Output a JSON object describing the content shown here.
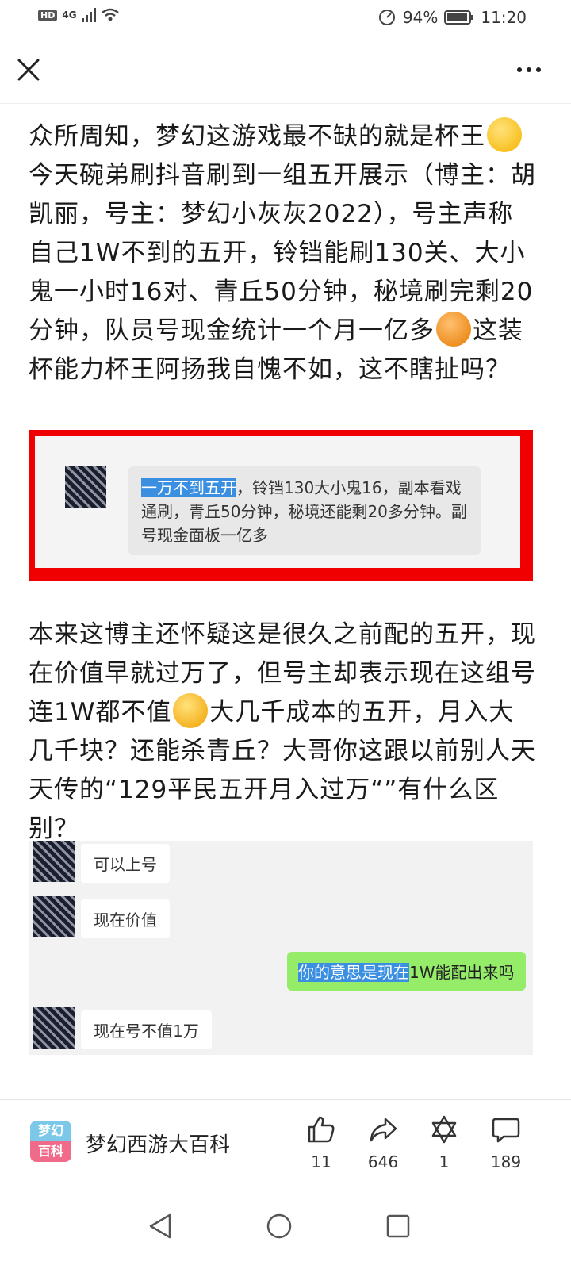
{
  "status_bar": {
    "hd": "HD",
    "network": "4G",
    "battery": "94%",
    "time": "11:20"
  },
  "article": {
    "para1": "众所周知，梦幻这游戏最不缺的就是杯王",
    "para1b": "今天碗弟刷抖音刷到一组五开展示（博主：胡凯丽，号主：梦幻小灰灰2022），号主声称自己1W不到的五开，铃铛能刷130关、大小鬼一小时16对、青丘50分钟，秘境刷完剩20分钟，队员号现金统计一个月一亿多",
    "para1c": "这装杯能力杯王阿扬我自愧不如，这不瞎扯吗？",
    "para2": "本来这博主还怀疑这是很久之前配的五开，现在价值早就过万了，但号主却表示现在这组号连1W都不值",
    "para2b": "大几千成本的五开，月入大几千块？还能杀青丘？大哥你这跟以前别人天天传的“129平民五开月入过万“”有什么区别？"
  },
  "screenshot1": {
    "highlight": "一万不到五开",
    "message": "，铃铛130大小鬼16，副本看戏通刷，青丘50分钟，秘境还能剩20多分钟。副号现金面板一亿多"
  },
  "screenshot2": {
    "msg1": "可以上号",
    "msg2": "现在价值",
    "msg3_highlight": "你的意思是现在",
    "msg3_rest": "1W能配出来吗",
    "msg4": "现在号不值1万"
  },
  "bottom_bar": {
    "logo_top": "梦幻",
    "logo_bottom": "百科",
    "account": "梦幻西游大百科",
    "likes": "11",
    "shares": "646",
    "favorites": "1",
    "comments": "189"
  },
  "colors": {
    "red_frame": "#f00000",
    "highlight": "#3a8fe0",
    "green_bubble": "#95ec69"
  }
}
